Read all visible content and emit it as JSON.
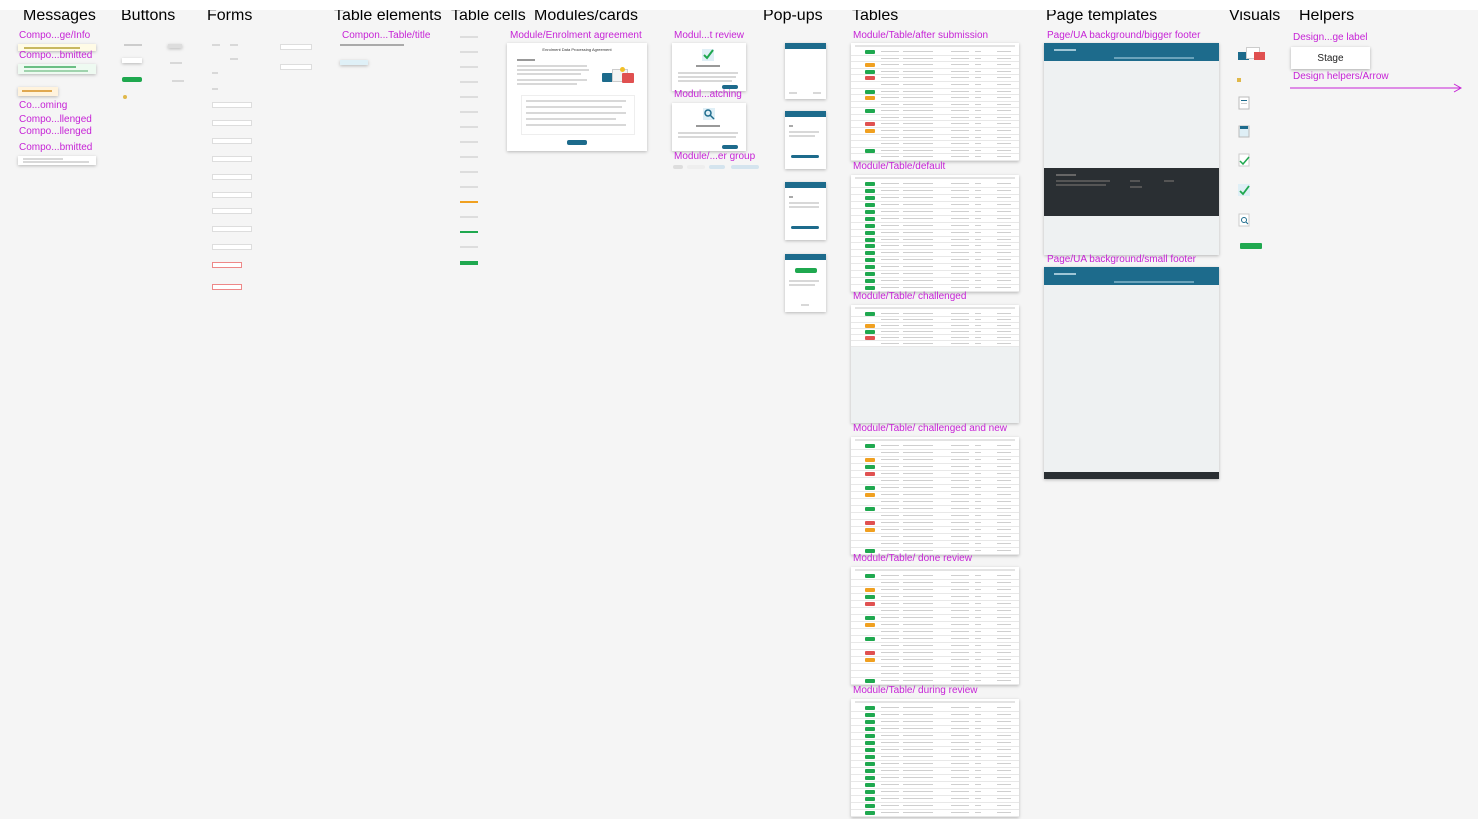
{
  "sections": {
    "messages": "Messages",
    "buttons": "Buttons",
    "forms": "Forms",
    "table_elements": "Table elements",
    "table_cells": "Table cells",
    "modules_cards": "Modules/cards",
    "pop_ups": "Pop-ups",
    "tables": "Tables",
    "page_templates": "Page templates",
    "visuals": "Visuals",
    "helpers": "Helpers"
  },
  "frame_labels": {
    "msg_info": "Compo...ge/Info",
    "msg_submitted": "Compo...bmitted",
    "msg_incoming": "Co...oming",
    "msg_challenged_1": "Compo...llenged",
    "msg_challenged_2": "Compo...llenged",
    "msg_submitted_2": "Compo...bmitted",
    "table_title": "Compon...Table/title",
    "enrolment_agreement": "Module/Enrolment agreement",
    "review": "Modul...t review",
    "matching": "Modul...atching",
    "filter_group": "Module/...er group",
    "table_after_submission": "Module/Table/after submission",
    "table_default": "Module/Table/default",
    "table_challenged": "Module/Table/ challenged",
    "table_challenged_new": "Module/Table/ challenged and new",
    "table_done_review": "Module/Table/ done review",
    "table_during_review": "Module/Table/ during review",
    "bigger_footer": "Page/UA background/bigger footer",
    "small_footer": "Page/UA background/small footer",
    "design_label": "Design...ge label",
    "design_arrow": "Design helpers/Arrow"
  },
  "stage_label": "Stage",
  "enrolment_title": "Enrolment Data Processing Agreement",
  "colors": {
    "canvas": "#f5f5f5",
    "frame_label": "#c623d6",
    "brand": "#1d6b8c",
    "accent_green": "#1fa84f",
    "footer_dark": "#2a2f33"
  }
}
